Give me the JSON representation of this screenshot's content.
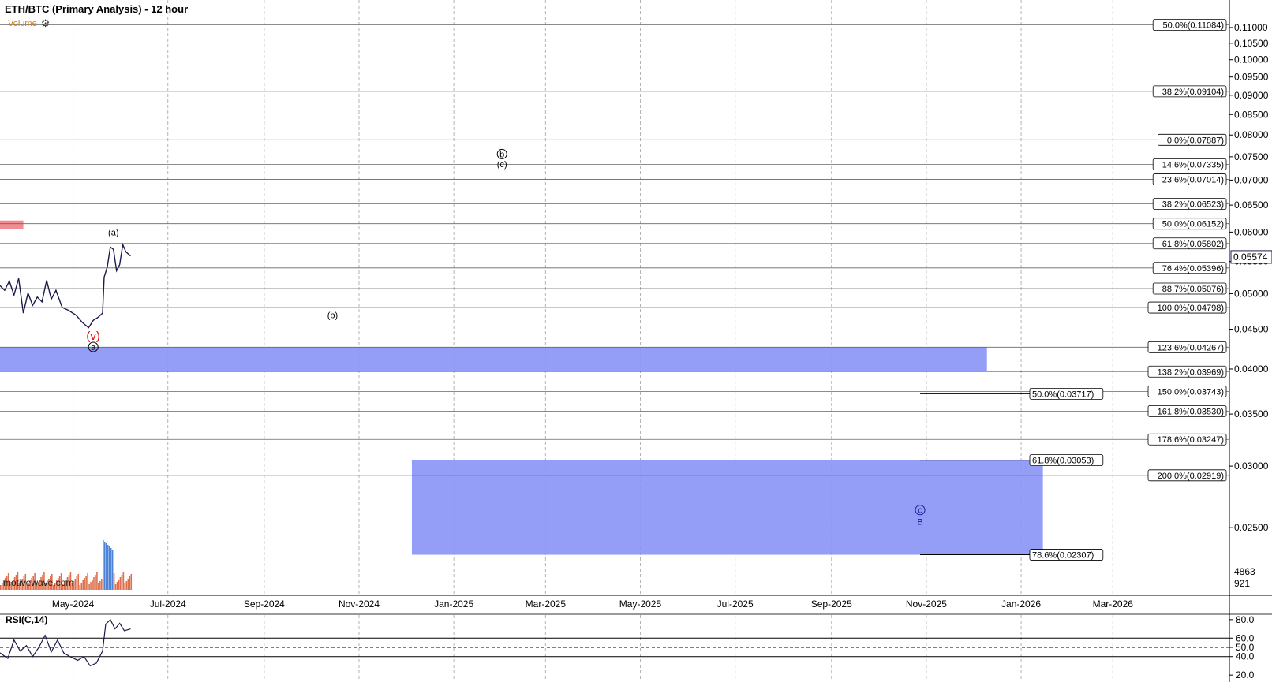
{
  "title": "ETH/BTC (Primary Analysis) - 12 hour",
  "volume_label": "Volume",
  "settings_icon": "gear-icon",
  "rsi_label": "RSI(C,14)",
  "watermark": "motivewave.com",
  "colors": {
    "zone": "#8c96f5",
    "red_zone": "#f27f86",
    "grid": "#b4b4b4",
    "line": "#666666",
    "wave_red": "#e00000",
    "wave_blue": "#1a1aa0",
    "volume": "#d9572b",
    "volume_spike": "#2e6fd1"
  },
  "chart_data": {
    "type": "line",
    "title": "ETH/BTC (Primary Analysis) - 12 hour",
    "scale": "log",
    "ylim": [
      0.0222,
      0.1139
    ],
    "xlim": [
      "2024-03-15",
      "2026-05-15"
    ],
    "x_ticks": [
      {
        "label": "May-2024",
        "date": "2024-05-01"
      },
      {
        "label": "Jul-2024",
        "date": "2024-07-01"
      },
      {
        "label": "Sep-2024",
        "date": "2024-09-01"
      },
      {
        "label": "Nov-2024",
        "date": "2024-11-01"
      },
      {
        "label": "Jan-2025",
        "date": "2025-01-01"
      },
      {
        "label": "Mar-2025",
        "date": "2025-03-01"
      },
      {
        "label": "May-2025",
        "date": "2025-05-01"
      },
      {
        "label": "Jul-2025",
        "date": "2025-07-01"
      },
      {
        "label": "Sep-2025",
        "date": "2025-09-01"
      },
      {
        "label": "Nov-2025",
        "date": "2025-11-01"
      },
      {
        "label": "Jan-2026",
        "date": "2026-01-01"
      },
      {
        "label": "Mar-2026",
        "date": "2026-03-01"
      }
    ],
    "y_ticks": [
      "0.02500",
      "0.03000",
      "0.03500",
      "0.04000",
      "0.04500",
      "0.05000",
      "0.05500",
      "0.06000",
      "0.06500",
      "0.07000",
      "0.07500",
      "0.08000",
      "0.08500",
      "0.09000",
      "0.09500",
      "0.10000",
      "0.10500",
      "0.11000"
    ],
    "last_price": "0.05574",
    "price_series": [
      [
        "2024-03-15",
        0.0512
      ],
      [
        "2024-03-18",
        0.0505
      ],
      [
        "2024-03-21",
        0.0519
      ],
      [
        "2024-03-24",
        0.0498
      ],
      [
        "2024-03-27",
        0.0523
      ],
      [
        "2024-03-30",
        0.0472
      ],
      [
        "2024-04-02",
        0.0501
      ],
      [
        "2024-04-05",
        0.0483
      ],
      [
        "2024-04-08",
        0.0495
      ],
      [
        "2024-04-11",
        0.0488
      ],
      [
        "2024-04-14",
        0.052
      ],
      [
        "2024-04-17",
        0.0492
      ],
      [
        "2024-04-20",
        0.0505
      ],
      [
        "2024-04-24",
        0.048
      ],
      [
        "2024-04-28",
        0.0476
      ],
      [
        "2024-05-03",
        0.0469
      ],
      [
        "2024-05-07",
        0.0459
      ],
      [
        "2024-05-11",
        0.0452
      ],
      [
        "2024-05-14",
        0.0462
      ],
      [
        "2024-05-17",
        0.0466
      ],
      [
        "2024-05-20",
        0.0472
      ],
      [
        "2024-05-21",
        0.0525
      ],
      [
        "2024-05-23",
        0.0541
      ],
      [
        "2024-05-25",
        0.0574
      ],
      [
        "2024-05-27",
        0.057
      ],
      [
        "2024-05-29",
        0.0535
      ],
      [
        "2024-05-31",
        0.0545
      ],
      [
        "2024-06-02",
        0.0578
      ],
      [
        "2024-06-04",
        0.0566
      ],
      [
        "2024-06-07",
        0.0559
      ]
    ],
    "horizontal_levels": [
      {
        "label": "50.0%(0.11084)",
        "value": 0.11084
      },
      {
        "label": "38.2%(0.09104)",
        "value": 0.09104
      },
      {
        "label": "0.0%(0.07887)",
        "value": 0.07887
      },
      {
        "label": "14.6%(0.07335)",
        "value": 0.07335
      },
      {
        "label": "23.6%(0.07014)",
        "value": 0.07014
      },
      {
        "label": "38.2%(0.06523)",
        "value": 0.06523
      },
      {
        "label": "50.0%(0.06152)",
        "value": 0.06152
      },
      {
        "label": "61.8%(0.05802)",
        "value": 0.05802
      },
      {
        "label": "76.4%(0.05396)",
        "value": 0.05396
      },
      {
        "label": "88.7%(0.05076)",
        "value": 0.05076
      },
      {
        "label": "100.0%(0.04798)",
        "value": 0.04798
      },
      {
        "label": "123.6%(0.04267)",
        "value": 0.04267
      },
      {
        "label": "138.2%(0.03969)",
        "value": 0.03969
      },
      {
        "label": "150.0%(0.03743)",
        "value": 0.03743
      },
      {
        "label": "161.8%(0.03530)",
        "value": 0.0353
      },
      {
        "label": "178.6%(0.03247)",
        "value": 0.03247
      },
      {
        "label": "200.0%(0.02919)",
        "value": 0.02919
      }
    ],
    "extension_levels": [
      {
        "label": "50.0%(0.03717)",
        "value": 0.03717
      },
      {
        "label": "61.8%(0.03053)",
        "value": 0.03053
      },
      {
        "label": "78.6%(0.02307)",
        "value": 0.02307
      }
    ],
    "zones": [
      {
        "name": "upper-support-zone",
        "x0": "2024-03-15",
        "x1": "2025-12-10",
        "y_top": 0.04267,
        "y_bottom": 0.03969
      },
      {
        "name": "target-zone",
        "x0": "2024-12-05",
        "x1": "2026-01-15",
        "y_top": 0.03053,
        "y_bottom": 0.02307
      },
      {
        "name": "resistance-marker",
        "x0": "2024-03-15",
        "x1": "2024-03-30",
        "y_top": 0.0621,
        "y_bottom": 0.0605
      }
    ],
    "wave_labels": [
      {
        "text": "(a)",
        "x": "2024-05-27",
        "y": 0.0594,
        "color": "black"
      },
      {
        "text": "b",
        "x": "2025-02-01",
        "y": 0.0749,
        "color": "black",
        "circled": true
      },
      {
        "text": "(c)",
        "x": "2025-02-01",
        "y": 0.0727,
        "color": "black"
      },
      {
        "text": "(b)",
        "x": "2024-10-15",
        "y": 0.0465,
        "color": "black"
      },
      {
        "text": "(v)",
        "x": "2024-05-14",
        "y": 0.0436,
        "color": "red"
      },
      {
        "text": "a",
        "x": "2024-05-14",
        "y": 0.0423,
        "color": "black",
        "circled": true
      },
      {
        "text": "c",
        "x": "2025-10-28",
        "y": 0.0261,
        "color": "blue",
        "circled": true
      },
      {
        "text": "B",
        "x": "2025-10-28",
        "y": 0.0252,
        "color": "blue"
      }
    ],
    "volume_axis_labels": [
      "4863",
      "921"
    ],
    "rsi": {
      "name": "RSI(C,14)",
      "ylim": [
        15,
        85
      ],
      "ticks": [
        "80.0",
        "60.0",
        "50.0",
        "40.0",
        "20.0"
      ],
      "levels": [
        60,
        50,
        40
      ],
      "current": "61.8",
      "series": [
        [
          "2024-03-15",
          44
        ],
        [
          "2024-03-20",
          38
        ],
        [
          "2024-03-24",
          58
        ],
        [
          "2024-03-28",
          46
        ],
        [
          "2024-04-01",
          52
        ],
        [
          "2024-04-05",
          40
        ],
        [
          "2024-04-09",
          50
        ],
        [
          "2024-04-13",
          63
        ],
        [
          "2024-04-17",
          45
        ],
        [
          "2024-04-21",
          58
        ],
        [
          "2024-04-25",
          44
        ],
        [
          "2024-04-29",
          40
        ],
        [
          "2024-05-04",
          36
        ],
        [
          "2024-05-08",
          40
        ],
        [
          "2024-05-12",
          30
        ],
        [
          "2024-05-16",
          33
        ],
        [
          "2024-05-20",
          46
        ],
        [
          "2024-05-22",
          75
        ],
        [
          "2024-05-25",
          80
        ],
        [
          "2024-05-28",
          70
        ],
        [
          "2024-05-31",
          76
        ],
        [
          "2024-06-03",
          68
        ],
        [
          "2024-06-07",
          70
        ]
      ]
    }
  }
}
